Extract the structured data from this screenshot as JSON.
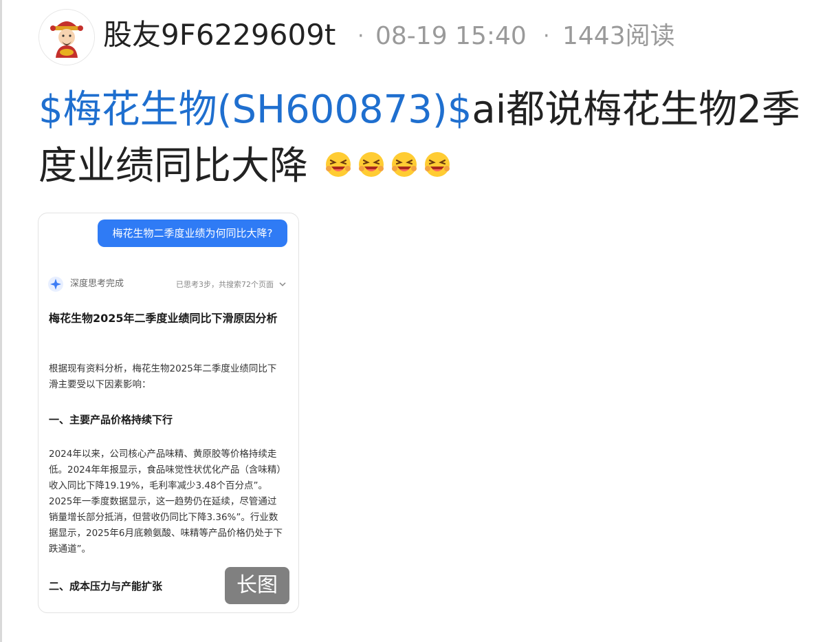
{
  "post": {
    "author": "股友9F6229609t",
    "date": "08-19 15:40",
    "reads": "1443阅读",
    "title_stock": "$梅花生物(SH600873)$",
    "title_rest_line1": "ai都说梅花生物2季",
    "title_line2": "度业绩同比大降",
    "emoji_names": [
      "laughing-face-icon",
      "laughing-face-icon",
      "laughing-face-icon",
      "laughing-face-icon"
    ]
  },
  "screenshot": {
    "question": "梅花生物二季度业绩为何同比大降?",
    "think_label": "深度思考完成",
    "think_meta": "已思考3步，共搜索72个页面",
    "answer_title": "梅花生物2025年二季度业绩同比下滑原因分析",
    "intro": "根据现有资料分析，梅花生物2025年二季度业绩同比下滑主要受以下因素影响：",
    "section1": "一、主要产品价格持续下行",
    "section1_body": "2024年以来，公司核心产品味精、黄原胶等价格持续走低。2024年年报显示，食品味觉性状优化产品（含味精）收入同比下降19.19%，毛利率减少3.48个百分点”。2025年一季度数据显示，这一趋势仍在延续，尽管通过销量增长部分抵消，但营收仍同比下降3.36%”。行业数据显示，2025年6月底赖氨酸、味精等产品价格仍处于下跌通道”。",
    "section2": "二、成本压力与产能扩张",
    "long_image_label": "长图"
  },
  "colors": {
    "stock_link": "#1f6fcf",
    "question_bubble": "#2f7bf5",
    "meta_text": "#9a9a9a"
  }
}
